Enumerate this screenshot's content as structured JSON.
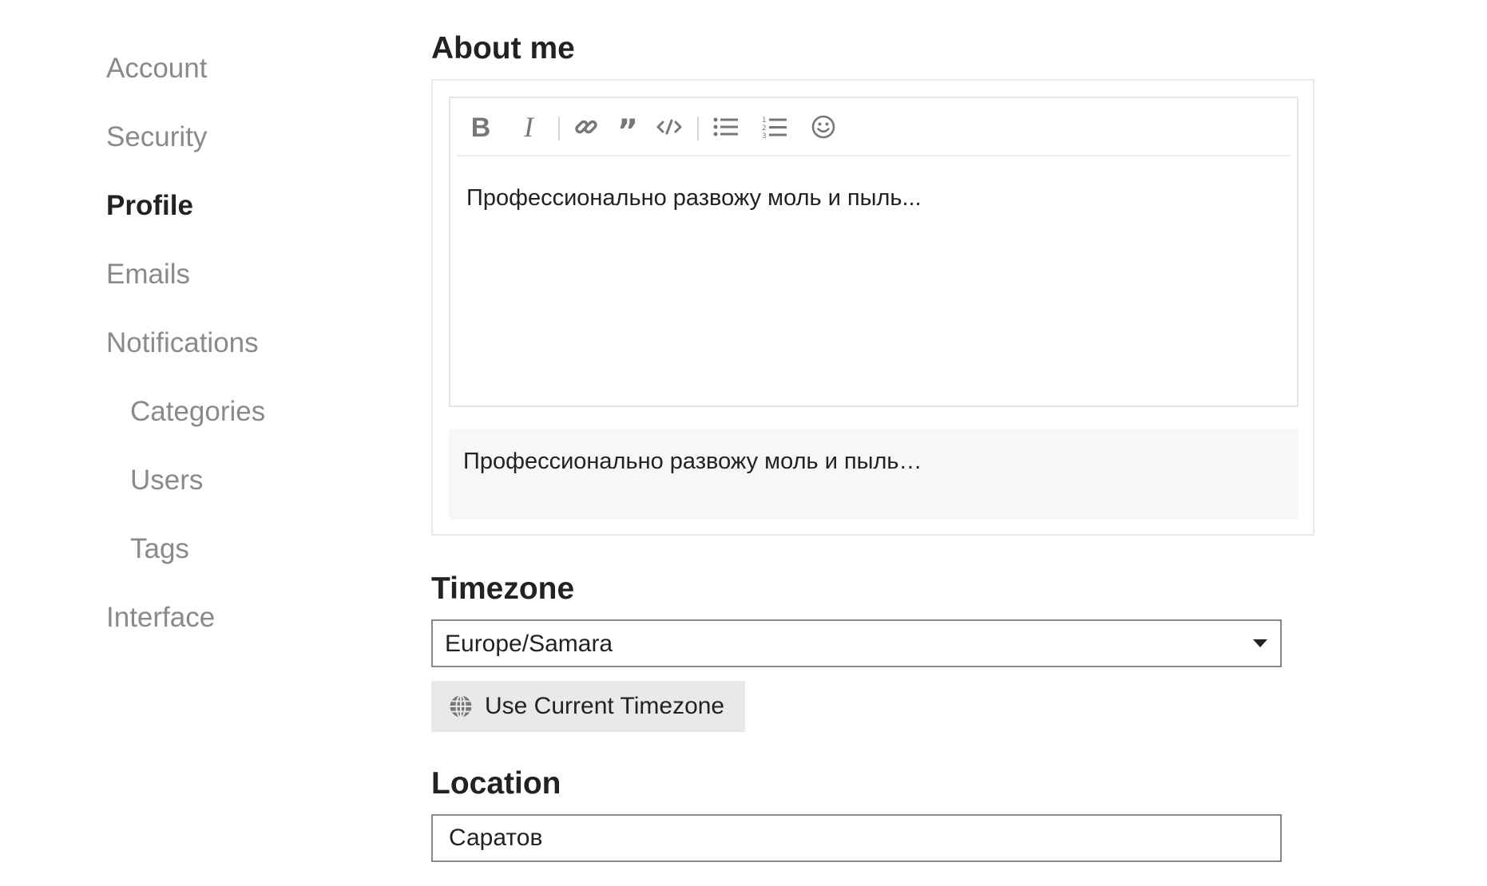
{
  "sidebar": {
    "items": [
      {
        "label": "Account",
        "active": false,
        "sub": false
      },
      {
        "label": "Security",
        "active": false,
        "sub": false
      },
      {
        "label": "Profile",
        "active": true,
        "sub": false
      },
      {
        "label": "Emails",
        "active": false,
        "sub": false
      },
      {
        "label": "Notifications",
        "active": false,
        "sub": false
      },
      {
        "label": "Categories",
        "active": false,
        "sub": true
      },
      {
        "label": "Users",
        "active": false,
        "sub": true
      },
      {
        "label": "Tags",
        "active": false,
        "sub": true
      },
      {
        "label": "Interface",
        "active": false,
        "sub": false
      }
    ]
  },
  "about": {
    "title": "About me",
    "toolbar": [
      {
        "name": "bold-icon",
        "kind": "button"
      },
      {
        "name": "italic-icon",
        "kind": "button"
      },
      {
        "name": "separator",
        "kind": "separator"
      },
      {
        "name": "link-icon",
        "kind": "button"
      },
      {
        "name": "quote-icon",
        "kind": "button"
      },
      {
        "name": "code-icon",
        "kind": "button"
      },
      {
        "name": "separator",
        "kind": "separator"
      },
      {
        "name": "bullet-list-icon",
        "kind": "button"
      },
      {
        "name": "numbered-list-icon",
        "kind": "button"
      },
      {
        "name": "emoji-icon",
        "kind": "button"
      }
    ],
    "text": "Профессионально развожу моль и пыль...",
    "preview": "Профессионально развожу моль и пыль…"
  },
  "timezone": {
    "title": "Timezone",
    "selected": "Europe/Samara",
    "button_label": "Use Current Timezone",
    "button_icon": "globe-icon"
  },
  "location": {
    "title": "Location",
    "value": "Саратов"
  },
  "colors": {
    "text": "#222222",
    "muted": "#8a8a8a",
    "icon": "#777777",
    "border": "#e9e9e9",
    "input_border": "#888888",
    "button_bg": "#e9e9e9",
    "preview_bg": "#f7f7f7"
  }
}
